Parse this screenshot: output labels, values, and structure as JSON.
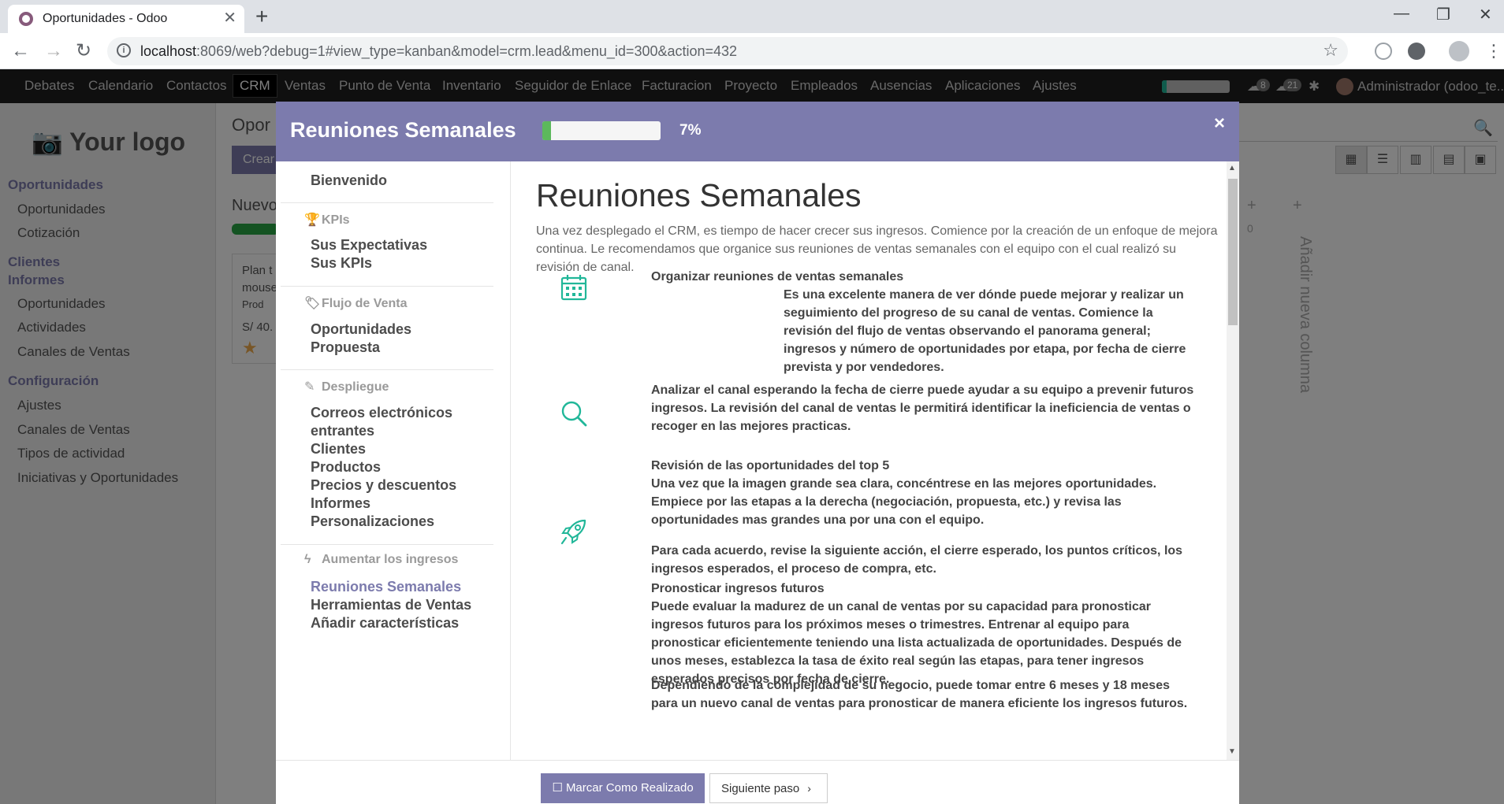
{
  "browser": {
    "tab_title": "Oportunidades - Odoo",
    "url_host": "localhost",
    "url_rest": ":8069/web?debug=1#view_type=kanban&model=crm.lead&menu_id=300&action=432"
  },
  "navbar": {
    "items": [
      "Debates",
      "Calendario",
      "Contactos",
      "CRM",
      "Ventas",
      "Punto de Venta",
      "Inventario",
      "Seguidor de Enlace",
      "Facturacion",
      "Proyecto",
      "Empleados",
      "Ausencias",
      "Aplicaciones",
      "Ajustes"
    ],
    "active": "CRM",
    "messages_count": "8",
    "activities_count": "21",
    "user": "Administrador (odoo_te..."
  },
  "sidebar": {
    "logo": "Your logo",
    "sections": [
      {
        "head": "Oportunidades",
        "items": [
          "Oportunidades",
          "Cotización"
        ]
      },
      {
        "head": "Clientes",
        "items": []
      },
      {
        "head": "Informes",
        "items": [
          "Oportunidades",
          "Actividades",
          "Canales de Ventas"
        ]
      },
      {
        "head": "Configuración",
        "items": [
          "Ajustes",
          "Canales de Ventas",
          "Tipos de actividad",
          "Iniciativas y Oportunidades"
        ]
      }
    ]
  },
  "content": {
    "title": "Opor",
    "create_button": "Crear",
    "column_head": "Nuevo",
    "card_lines": [
      "Plan t",
      "mouse",
      "Prod",
      "S/ 40."
    ],
    "add_column": "Añadir nueva columna",
    "add_column_count": "0"
  },
  "modal": {
    "title": "Reuniones Semanales",
    "progress_percent": 7,
    "progress_label": "7%",
    "left_nav": {
      "welcome": "Bienvenido",
      "categories": [
        {
          "label": "KPIs",
          "icon": "trophy-icon",
          "items": [
            "Sus Expectativas",
            "Sus KPIs"
          ]
        },
        {
          "label": "Flujo de Venta",
          "icon": "tag-icon",
          "items": [
            "Oportunidades",
            "Propuesta"
          ]
        },
        {
          "label": "Despliegue",
          "icon": "magic-wand-icon",
          "items": [
            "Correos electrónicos",
            "entrantes",
            "Clientes",
            "Productos",
            "Precios y descuentos",
            "Informes",
            "Personalizaciones"
          ]
        },
        {
          "label": "Aumentar los ingresos",
          "icon": "bolt-icon",
          "items": [
            "Reuniones Semanales",
            "Herramientas de Ventas",
            "Añadir características"
          ]
        }
      ],
      "active_item": "Reuniones Semanales"
    },
    "main": {
      "heading": "Reuniones Semanales",
      "intro": "Una vez desplegado el CRM, es tiempo de hacer crecer sus ingresos. Comience por la creación de un enfoque de mejora continua. Le recomendamos que organice sus reuniones de ventas semanales con el equipo con el cual realizó su revisión de canal.",
      "block1_title": "Organizar reuniones de ventas semanales",
      "block1_text": "Es una excelente manera de ver dónde puede mejorar y realizar un seguimiento del progreso de su canal de ventas. Comience la revisión del flujo de ventas observando el panorama general; ingresos y número de oportunidades por etapa, por fecha de cierre prevista y por vendedores.",
      "block1_text2": "Analizar el canal esperando la fecha de cierre puede ayudar a su equipo a prevenir futuros ingresos. La revisión del canal de ventas le permitirá identificar la ineficiencia de ventas o recoger en las mejores practicas.",
      "block2_title": "Revisión de las oportunidades del top 5",
      "block2_text": "Una vez que la imagen grande sea clara, concéntrese en las mejores oportunidades. Empiece por las etapas a la derecha (negociación, propuesta, etc.) y revisa las oportunidades mas grandes una por una con el equipo.",
      "block2_text2": "Para cada acuerdo, revise la siguiente acción, el cierre esperado, los puntos críticos, los ingresos esperados, el proceso de compra, etc.",
      "block3_title": "Pronosticar ingresos futuros",
      "block3_text": "Puede evaluar la madurez de un canal de ventas por su capacidad para pronosticar ingresos futuros para los próximos meses o trimestres. Entrenar al equipo para pronosticar eficientemente teniendo una lista actualizada de oportunidades. Después de unos meses, establezca la tasa de éxito real según las etapas, para tener ingresos esperados precisos por fecha de cierre.",
      "block3_text2": "Dependiendo de la complejidad de su negocio, puede tomar entre 6 meses y 18 meses para un nuevo canal de ventas para pronosticar de manera eficiente los ingresos futuros."
    },
    "footer": {
      "done_button": "Marcar Como Realizado",
      "next_button": "Siguiente paso"
    },
    "accent_color": "#7c7bad",
    "icon_color": "#21b799"
  }
}
